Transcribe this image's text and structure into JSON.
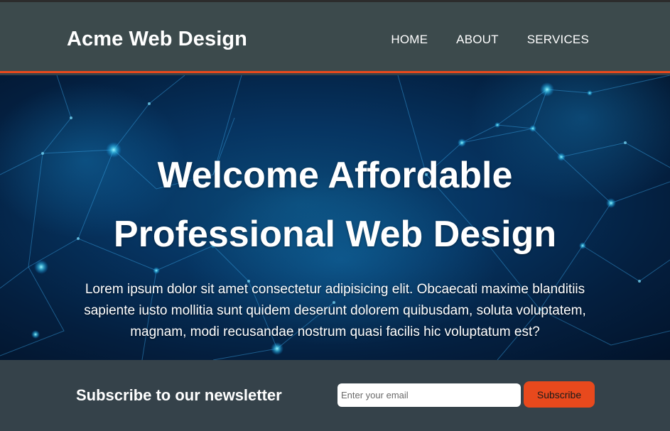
{
  "header": {
    "logo": "Acme Web Design",
    "nav": [
      {
        "label": "HOME"
      },
      {
        "label": "ABOUT"
      },
      {
        "label": "SERVICES"
      }
    ]
  },
  "showcase": {
    "title_line1": "Welcome Affordable",
    "title_line2": "Professional Web Design",
    "text": "Lorem ipsum dolor sit amet consectetur adipisicing elit. Obcaecati maxime blanditiis sapiente iusto mollitia sunt quidem deserunt dolorem quibusdam, soluta voluptatem, magnam, modi recusandae nostrum quasi facilis hic voluptatum est?"
  },
  "newsletter": {
    "heading": "Subscribe to our newsletter",
    "email_placeholder": "Enter your email",
    "button_label": "Subscribe"
  },
  "colors": {
    "accent": "#e8491d",
    "header_bg": "#3c4a4c",
    "dark_bg": "#35424a"
  }
}
